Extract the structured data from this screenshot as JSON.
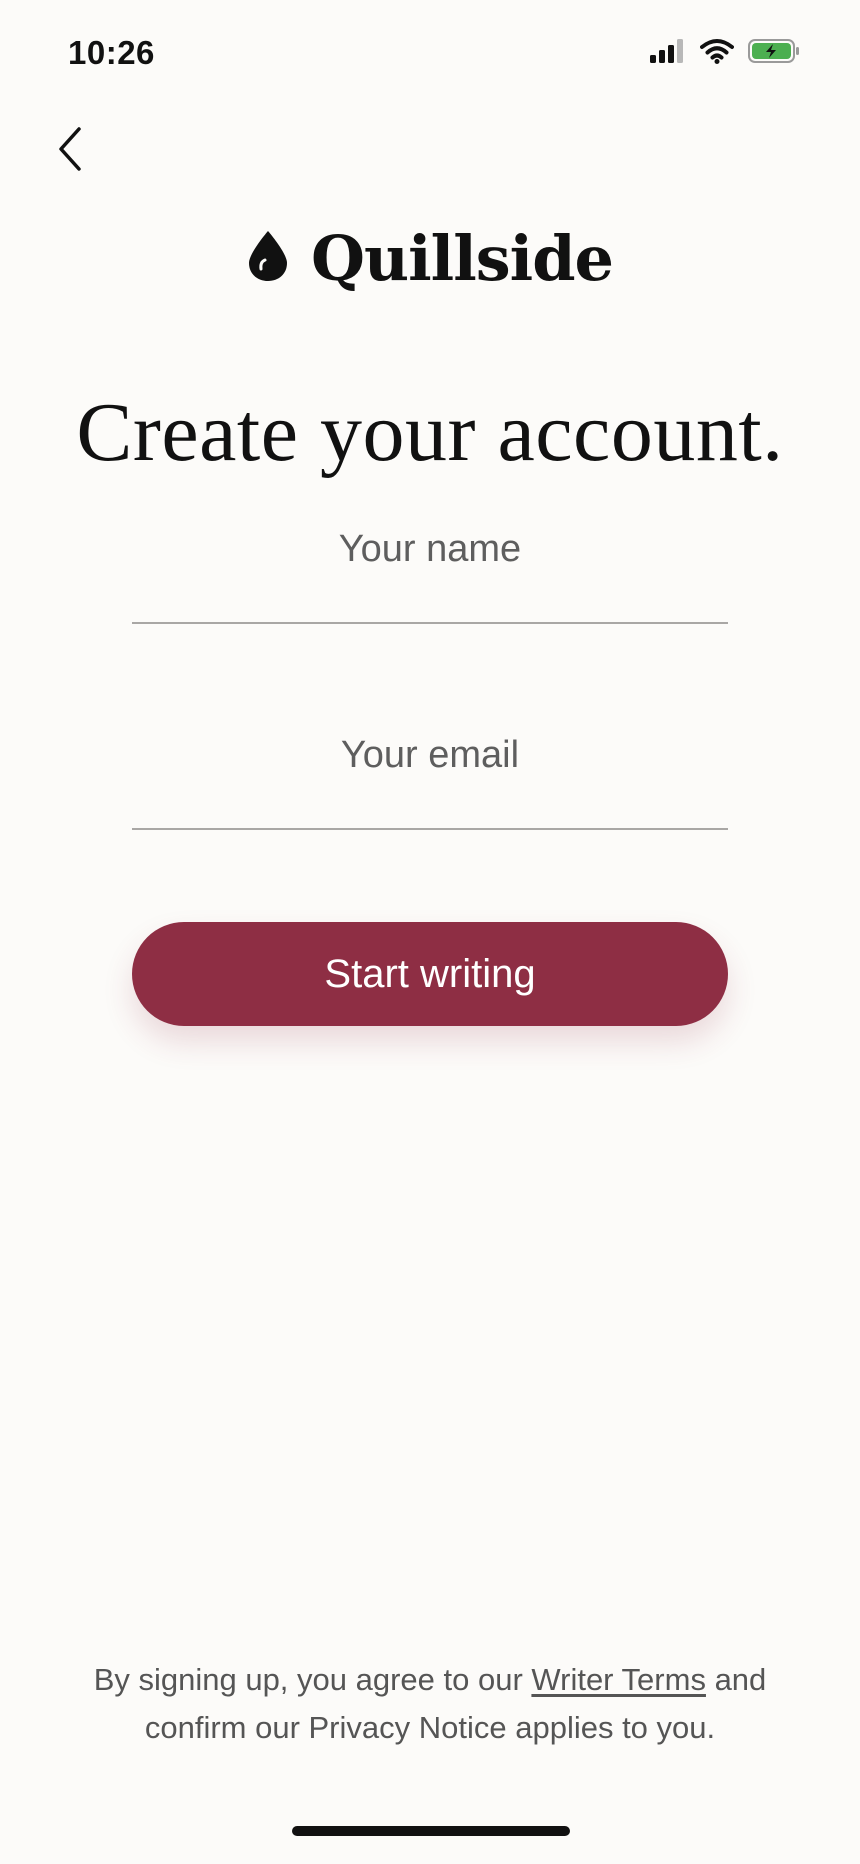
{
  "status_bar": {
    "time": "10:26",
    "signal_icon": "cellular-signal-icon",
    "wifi_icon": "wifi-icon",
    "battery_icon": "battery-charging-icon",
    "battery_color": "#4caf50"
  },
  "nav": {
    "back_icon": "chevron-left-icon"
  },
  "brand": {
    "logo_icon": "ink-drop-icon",
    "name": "Quillside"
  },
  "headline": "Create your account.",
  "form": {
    "name_placeholder": "Your name",
    "name_value": "",
    "email_placeholder": "Your email",
    "email_value": "",
    "submit_label": "Start writing",
    "submit_color": "#8e2e44"
  },
  "legal": {
    "prefix": "By signing up, you agree to our ",
    "terms_link": "Writer Terms",
    "suffix": " and confirm our Privacy Notice applies to you."
  }
}
